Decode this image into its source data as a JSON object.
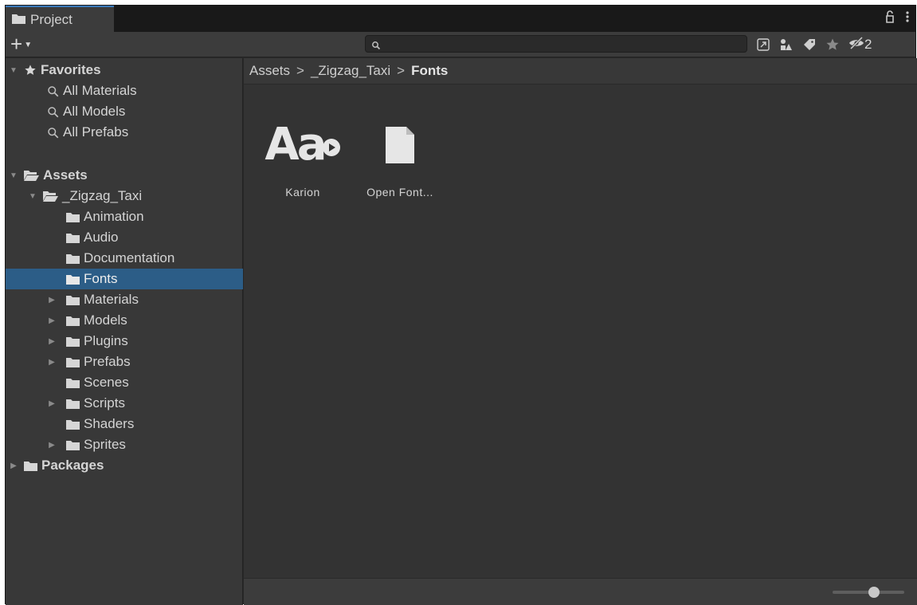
{
  "tab": {
    "label": "Project"
  },
  "toolbar": {
    "search_placeholder": "",
    "hidden_count": "2"
  },
  "tree": {
    "favorites": {
      "label": "Favorites",
      "items": [
        "All Materials",
        "All Models",
        "All Prefabs"
      ]
    },
    "assets": {
      "label": "Assets"
    },
    "zigzag": {
      "label": "_Zigzag_Taxi"
    },
    "folders": [
      {
        "label": "Animation",
        "expandable": false
      },
      {
        "label": "Audio",
        "expandable": false
      },
      {
        "label": "Documentation",
        "expandable": false
      },
      {
        "label": "Fonts",
        "expandable": false
      },
      {
        "label": "Materials",
        "expandable": true
      },
      {
        "label": "Models",
        "expandable": true
      },
      {
        "label": "Plugins",
        "expandable": true
      },
      {
        "label": "Prefabs",
        "expandable": true
      },
      {
        "label": "Scenes",
        "expandable": false
      },
      {
        "label": "Scripts",
        "expandable": true
      },
      {
        "label": "Shaders",
        "expandable": false
      },
      {
        "label": "Sprites",
        "expandable": true
      }
    ],
    "packages": {
      "label": "Packages"
    },
    "selected_folder": "Fonts"
  },
  "breadcrumb": [
    "Assets",
    "_Zigzag_Taxi",
    "Fonts"
  ],
  "breadcrumb_sep": ">",
  "assets_grid": [
    {
      "name": "Karion",
      "icon": "font-asset-icon",
      "thumb_text": "Aa"
    },
    {
      "name": "Open Font...",
      "icon": "document-icon"
    }
  ],
  "colors": {
    "selection": "#2c5d87",
    "tab_accent": "#3a79bb",
    "panel": "#383838",
    "content": "#333333"
  }
}
